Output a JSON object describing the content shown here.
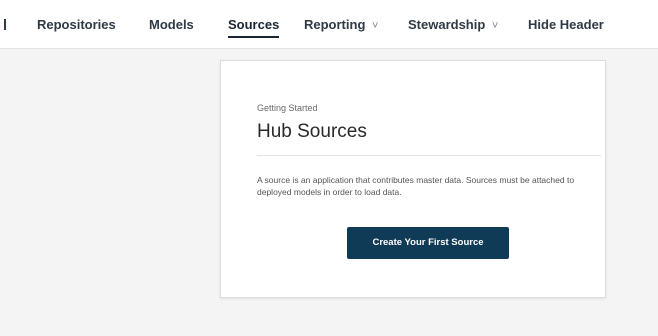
{
  "nav": {
    "items": [
      {
        "label": "Repositories",
        "dropdown": false,
        "active": false
      },
      {
        "label": "Models",
        "dropdown": false,
        "active": false
      },
      {
        "label": "Sources",
        "dropdown": false,
        "active": true
      },
      {
        "label": "Reporting",
        "dropdown": true,
        "active": false
      },
      {
        "label": "Stewardship",
        "dropdown": true,
        "active": false
      },
      {
        "label": "Hide Header",
        "dropdown": false,
        "active": false
      }
    ],
    "caret": "˅"
  },
  "card": {
    "eyebrow": "Getting Started",
    "title": "Hub Sources",
    "description": "A source is an application that contributes master data. Sources must be attached to deployed models in order to load data.",
    "cta_label": "Create Your First Source"
  },
  "colors": {
    "cta_background": "#0f3b57",
    "page_background": "#f4f4f4"
  }
}
